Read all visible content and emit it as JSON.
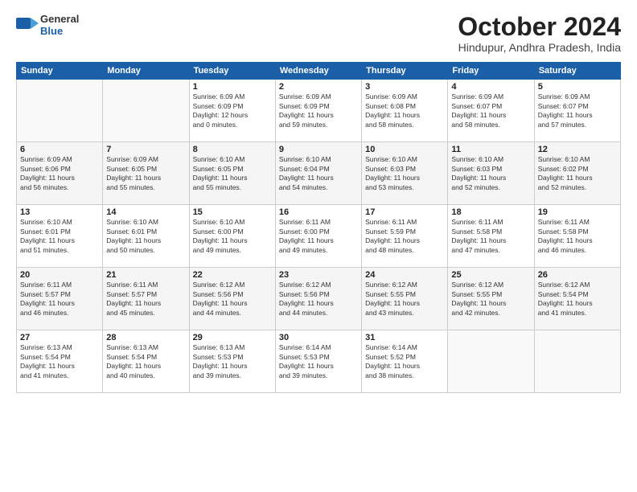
{
  "header": {
    "logo_general": "General",
    "logo_blue": "Blue",
    "month_title": "October 2024",
    "location": "Hindupur, Andhra Pradesh, India"
  },
  "days_of_week": [
    "Sunday",
    "Monday",
    "Tuesday",
    "Wednesday",
    "Thursday",
    "Friday",
    "Saturday"
  ],
  "weeks": [
    [
      {
        "day": "",
        "info": ""
      },
      {
        "day": "",
        "info": ""
      },
      {
        "day": "1",
        "info": "Sunrise: 6:09 AM\nSunset: 6:09 PM\nDaylight: 12 hours\nand 0 minutes."
      },
      {
        "day": "2",
        "info": "Sunrise: 6:09 AM\nSunset: 6:09 PM\nDaylight: 11 hours\nand 59 minutes."
      },
      {
        "day": "3",
        "info": "Sunrise: 6:09 AM\nSunset: 6:08 PM\nDaylight: 11 hours\nand 58 minutes."
      },
      {
        "day": "4",
        "info": "Sunrise: 6:09 AM\nSunset: 6:07 PM\nDaylight: 11 hours\nand 58 minutes."
      },
      {
        "day": "5",
        "info": "Sunrise: 6:09 AM\nSunset: 6:07 PM\nDaylight: 11 hours\nand 57 minutes."
      }
    ],
    [
      {
        "day": "6",
        "info": "Sunrise: 6:09 AM\nSunset: 6:06 PM\nDaylight: 11 hours\nand 56 minutes."
      },
      {
        "day": "7",
        "info": "Sunrise: 6:09 AM\nSunset: 6:05 PM\nDaylight: 11 hours\nand 55 minutes."
      },
      {
        "day": "8",
        "info": "Sunrise: 6:10 AM\nSunset: 6:05 PM\nDaylight: 11 hours\nand 55 minutes."
      },
      {
        "day": "9",
        "info": "Sunrise: 6:10 AM\nSunset: 6:04 PM\nDaylight: 11 hours\nand 54 minutes."
      },
      {
        "day": "10",
        "info": "Sunrise: 6:10 AM\nSunset: 6:03 PM\nDaylight: 11 hours\nand 53 minutes."
      },
      {
        "day": "11",
        "info": "Sunrise: 6:10 AM\nSunset: 6:03 PM\nDaylight: 11 hours\nand 52 minutes."
      },
      {
        "day": "12",
        "info": "Sunrise: 6:10 AM\nSunset: 6:02 PM\nDaylight: 11 hours\nand 52 minutes."
      }
    ],
    [
      {
        "day": "13",
        "info": "Sunrise: 6:10 AM\nSunset: 6:01 PM\nDaylight: 11 hours\nand 51 minutes."
      },
      {
        "day": "14",
        "info": "Sunrise: 6:10 AM\nSunset: 6:01 PM\nDaylight: 11 hours\nand 50 minutes."
      },
      {
        "day": "15",
        "info": "Sunrise: 6:10 AM\nSunset: 6:00 PM\nDaylight: 11 hours\nand 49 minutes."
      },
      {
        "day": "16",
        "info": "Sunrise: 6:11 AM\nSunset: 6:00 PM\nDaylight: 11 hours\nand 49 minutes."
      },
      {
        "day": "17",
        "info": "Sunrise: 6:11 AM\nSunset: 5:59 PM\nDaylight: 11 hours\nand 48 minutes."
      },
      {
        "day": "18",
        "info": "Sunrise: 6:11 AM\nSunset: 5:58 PM\nDaylight: 11 hours\nand 47 minutes."
      },
      {
        "day": "19",
        "info": "Sunrise: 6:11 AM\nSunset: 5:58 PM\nDaylight: 11 hours\nand 46 minutes."
      }
    ],
    [
      {
        "day": "20",
        "info": "Sunrise: 6:11 AM\nSunset: 5:57 PM\nDaylight: 11 hours\nand 46 minutes."
      },
      {
        "day": "21",
        "info": "Sunrise: 6:11 AM\nSunset: 5:57 PM\nDaylight: 11 hours\nand 45 minutes."
      },
      {
        "day": "22",
        "info": "Sunrise: 6:12 AM\nSunset: 5:56 PM\nDaylight: 11 hours\nand 44 minutes."
      },
      {
        "day": "23",
        "info": "Sunrise: 6:12 AM\nSunset: 5:56 PM\nDaylight: 11 hours\nand 44 minutes."
      },
      {
        "day": "24",
        "info": "Sunrise: 6:12 AM\nSunset: 5:55 PM\nDaylight: 11 hours\nand 43 minutes."
      },
      {
        "day": "25",
        "info": "Sunrise: 6:12 AM\nSunset: 5:55 PM\nDaylight: 11 hours\nand 42 minutes."
      },
      {
        "day": "26",
        "info": "Sunrise: 6:12 AM\nSunset: 5:54 PM\nDaylight: 11 hours\nand 41 minutes."
      }
    ],
    [
      {
        "day": "27",
        "info": "Sunrise: 6:13 AM\nSunset: 5:54 PM\nDaylight: 11 hours\nand 41 minutes."
      },
      {
        "day": "28",
        "info": "Sunrise: 6:13 AM\nSunset: 5:54 PM\nDaylight: 11 hours\nand 40 minutes."
      },
      {
        "day": "29",
        "info": "Sunrise: 6:13 AM\nSunset: 5:53 PM\nDaylight: 11 hours\nand 39 minutes."
      },
      {
        "day": "30",
        "info": "Sunrise: 6:14 AM\nSunset: 5:53 PM\nDaylight: 11 hours\nand 39 minutes."
      },
      {
        "day": "31",
        "info": "Sunrise: 6:14 AM\nSunset: 5:52 PM\nDaylight: 11 hours\nand 38 minutes."
      },
      {
        "day": "",
        "info": ""
      },
      {
        "day": "",
        "info": ""
      }
    ]
  ]
}
